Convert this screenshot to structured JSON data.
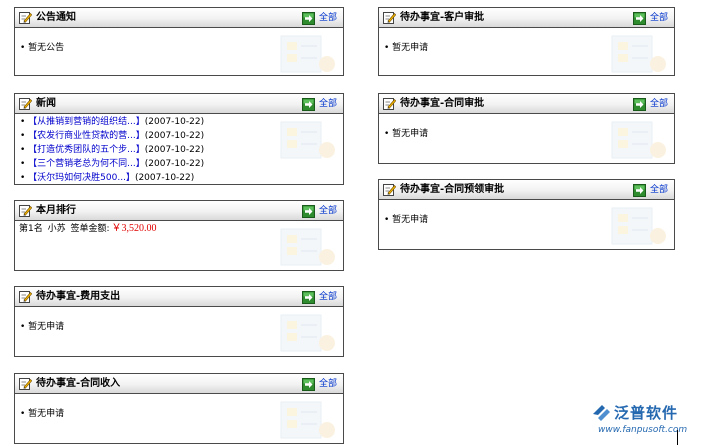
{
  "panels": {
    "announce": {
      "title": "公告通知",
      "more": "全部",
      "empty": "• 暂无公告"
    },
    "news": {
      "title": "新闻",
      "more": "全部",
      "items": [
        {
          "text": "【从推销到营销的组织结...】",
          "date": "(2007-10-22)"
        },
        {
          "text": "【农发行商业性贷款的营...】",
          "date": "(2007-10-22)"
        },
        {
          "text": "【打造优秀团队的五个步...】",
          "date": "(2007-10-22)"
        },
        {
          "text": "【三个营销老总为何不同...】",
          "date": "(2007-10-22)"
        },
        {
          "text": "【沃尔玛如何决胜500...】",
          "date": "(2007-10-22)"
        }
      ]
    },
    "ranking": {
      "title": "本月排行",
      "more": "全部",
      "rank": "第1名",
      "person": "小苏",
      "amount_label": "签单金额:",
      "amount": "￥3,520.00"
    },
    "expense": {
      "title": "待办事宜-费用支出",
      "more": "全部",
      "empty": "• 暂无申请"
    },
    "income": {
      "title": "待办事宜-合同收入",
      "more": "全部",
      "empty": "• 暂无申请"
    },
    "customer": {
      "title": "待办事宜-客户审批",
      "more": "全部",
      "empty": "• 暂无申请"
    },
    "contract": {
      "title": "待办事宜-合同审批",
      "more": "全部",
      "empty": "• 暂无申请"
    },
    "prereceipt": {
      "title": "待办事宜-合同预领审批",
      "more": "全部",
      "empty": "• 暂无申请"
    }
  },
  "logo": {
    "name": "泛普软件",
    "url": "www.fanpusoft.com"
  },
  "colors": {
    "link": "#0000cc",
    "more": "#0033cc",
    "amount": "#e00000",
    "arrow": "#2e8b2e",
    "logo": "#2468b0"
  },
  "icons": {
    "title": "edit-icon",
    "more": "arrow-right-icon"
  }
}
